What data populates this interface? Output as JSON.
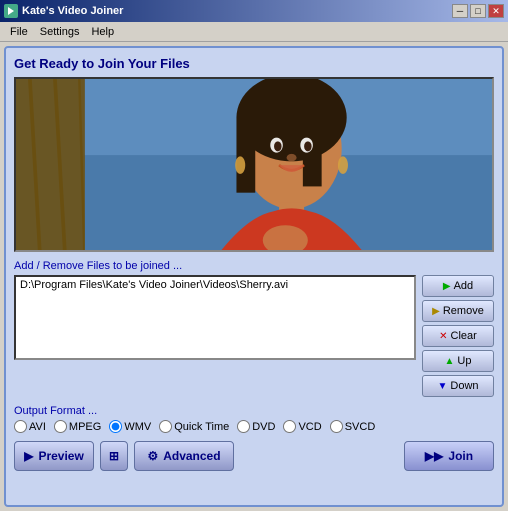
{
  "titlebar": {
    "title": "Kate's Video Joiner",
    "min_label": "─",
    "max_label": "□",
    "close_label": "✕"
  },
  "menubar": {
    "items": [
      "File",
      "Settings",
      "Help"
    ]
  },
  "main": {
    "header": "Get Ready to Join Your Files",
    "file_section_label": "Add / Remove Files to be joined ...",
    "file_list": [
      "D:\\Program Files\\Kate's Video Joiner\\Videos\\Sherry.avi"
    ],
    "output_label": "Output Format ...",
    "formats": [
      {
        "id": "avi",
        "label": "AVI"
      },
      {
        "id": "mpeg",
        "label": "MPEG"
      },
      {
        "id": "wmv",
        "label": "WMV",
        "checked": true
      },
      {
        "id": "qt",
        "label": "Quick Time"
      },
      {
        "id": "dvd",
        "label": "DVD"
      },
      {
        "id": "vcd",
        "label": "VCD"
      },
      {
        "id": "svcd",
        "label": "SVCD"
      }
    ],
    "buttons": {
      "add": "Add",
      "remove": "Remove",
      "clear": "Clear",
      "up": "Up",
      "down": "Down"
    },
    "bottom_buttons": {
      "preview": "Preview",
      "advanced": "Advanced",
      "join": "Join"
    }
  }
}
